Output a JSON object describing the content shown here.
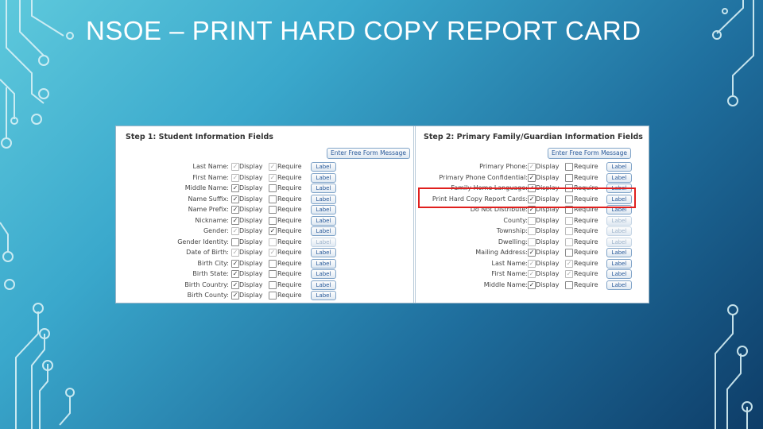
{
  "slide_title": "NSOE – PRINT HARD COPY REPORT CARD",
  "step1": {
    "title": "Step 1: Student Information Fields",
    "free_form_button": "Enter Free Form Message",
    "rows": [
      {
        "label": "Last Name:",
        "display": "Display",
        "display_checked": true,
        "display_dim": true,
        "require": "Require",
        "require_checked": true,
        "require_dim": true,
        "button": "Label"
      },
      {
        "label": "First Name:",
        "display": "Display",
        "display_checked": true,
        "display_dim": true,
        "require": "Require",
        "require_checked": true,
        "require_dim": true,
        "button": "Label"
      },
      {
        "label": "Middle Name:",
        "display": "Display",
        "display_checked": true,
        "display_dim": false,
        "require": "Require",
        "require_checked": false,
        "require_dim": false,
        "button": "Label"
      },
      {
        "label": "Name Suffix:",
        "display": "Display",
        "display_checked": true,
        "display_dim": false,
        "require": "Require",
        "require_checked": false,
        "require_dim": false,
        "button": "Label"
      },
      {
        "label": "Name Prefix:",
        "display": "Display",
        "display_checked": true,
        "display_dim": false,
        "require": "Require",
        "require_checked": false,
        "require_dim": false,
        "button": "Label"
      },
      {
        "label": "Nickname:",
        "display": "Display",
        "display_checked": true,
        "display_dim": false,
        "require": "Require",
        "require_checked": false,
        "require_dim": false,
        "button": "Label"
      },
      {
        "label": "Gender:",
        "display": "Display",
        "display_checked": true,
        "display_dim": true,
        "require": "Require",
        "require_checked": true,
        "require_dim": false,
        "button": "Label"
      },
      {
        "label": "Gender Identity:",
        "display": "Display",
        "display_checked": false,
        "display_dim": false,
        "require": "Require",
        "require_checked": false,
        "require_dim": true,
        "button": "Label",
        "button_dim": true
      },
      {
        "label": "Date of Birth:",
        "display": "Display",
        "display_checked": true,
        "display_dim": true,
        "require": "Require",
        "require_checked": true,
        "require_dim": true,
        "button": "Label"
      },
      {
        "label": "Birth City:",
        "display": "Display",
        "display_checked": true,
        "display_dim": false,
        "require": "Require",
        "require_checked": false,
        "require_dim": false,
        "button": "Label"
      },
      {
        "label": "Birth State:",
        "display": "Display",
        "display_checked": true,
        "display_dim": false,
        "require": "Require",
        "require_checked": false,
        "require_dim": false,
        "button": "Label"
      },
      {
        "label": "Birth Country:",
        "display": "Display",
        "display_checked": true,
        "display_dim": false,
        "require": "Require",
        "require_checked": false,
        "require_dim": false,
        "button": "Label"
      },
      {
        "label": "Birth County:",
        "display": "Display",
        "display_checked": true,
        "display_dim": false,
        "require": "Require",
        "require_checked": false,
        "require_dim": false,
        "button": "Label"
      }
    ]
  },
  "step2": {
    "title": "Step 2: Primary Family/Guardian Information Fields",
    "free_form_button": "Enter Free Form Message",
    "rows": [
      {
        "label": "Primary Phone:",
        "display": "Display",
        "display_checked": true,
        "display_dim": true,
        "require": "Require",
        "require_checked": false,
        "require_dim": false,
        "button": "Label"
      },
      {
        "label": "Primary Phone Confidential:",
        "display": "Display",
        "display_checked": true,
        "display_dim": false,
        "require": "Require",
        "require_checked": false,
        "require_dim": false,
        "button": "Label"
      },
      {
        "label": "Family Home Language:",
        "display": "Display",
        "display_checked": true,
        "display_dim": false,
        "require": "Require",
        "require_checked": false,
        "require_dim": false,
        "button": "Label",
        "partial": true
      },
      {
        "label": "Print Hard Copy Report Cards:",
        "display": "Display",
        "display_checked": true,
        "display_dim": false,
        "require": "Require",
        "require_checked": false,
        "require_dim": false,
        "button": "Label",
        "highlighted": true
      },
      {
        "label": "Do Not Distribute:",
        "display": "Display",
        "display_checked": true,
        "display_dim": false,
        "require": "Require",
        "require_checked": false,
        "require_dim": false,
        "button": "Label"
      },
      {
        "label": "County:",
        "display": "Display",
        "display_checked": false,
        "display_dim": true,
        "require": "Require",
        "require_checked": false,
        "require_dim": true,
        "button": "Label",
        "button_dim": true
      },
      {
        "label": "Township:",
        "display": "Display",
        "display_checked": false,
        "display_dim": true,
        "require": "Require",
        "require_checked": false,
        "require_dim": true,
        "button": "Label",
        "button_dim": true
      },
      {
        "label": "Dwelling:",
        "display": "Display",
        "display_checked": false,
        "display_dim": true,
        "require": "Require",
        "require_checked": false,
        "require_dim": true,
        "button": "Label",
        "button_dim": true
      },
      {
        "label": "Mailing Address:",
        "display": "Display",
        "display_checked": true,
        "display_dim": false,
        "require": "Require",
        "require_checked": false,
        "require_dim": false,
        "button": "Label"
      },
      {
        "label": "Last Name:",
        "display": "Display",
        "display_checked": true,
        "display_dim": true,
        "require": "Require",
        "require_checked": true,
        "require_dim": true,
        "button": "Label"
      },
      {
        "label": "First Name:",
        "display": "Display",
        "display_checked": true,
        "display_dim": true,
        "require": "Require",
        "require_checked": true,
        "require_dim": true,
        "button": "Label"
      },
      {
        "label": "Middle Name:",
        "display": "Display",
        "display_checked": true,
        "display_dim": false,
        "require": "Require",
        "require_checked": false,
        "require_dim": false,
        "button": "Label"
      }
    ]
  }
}
